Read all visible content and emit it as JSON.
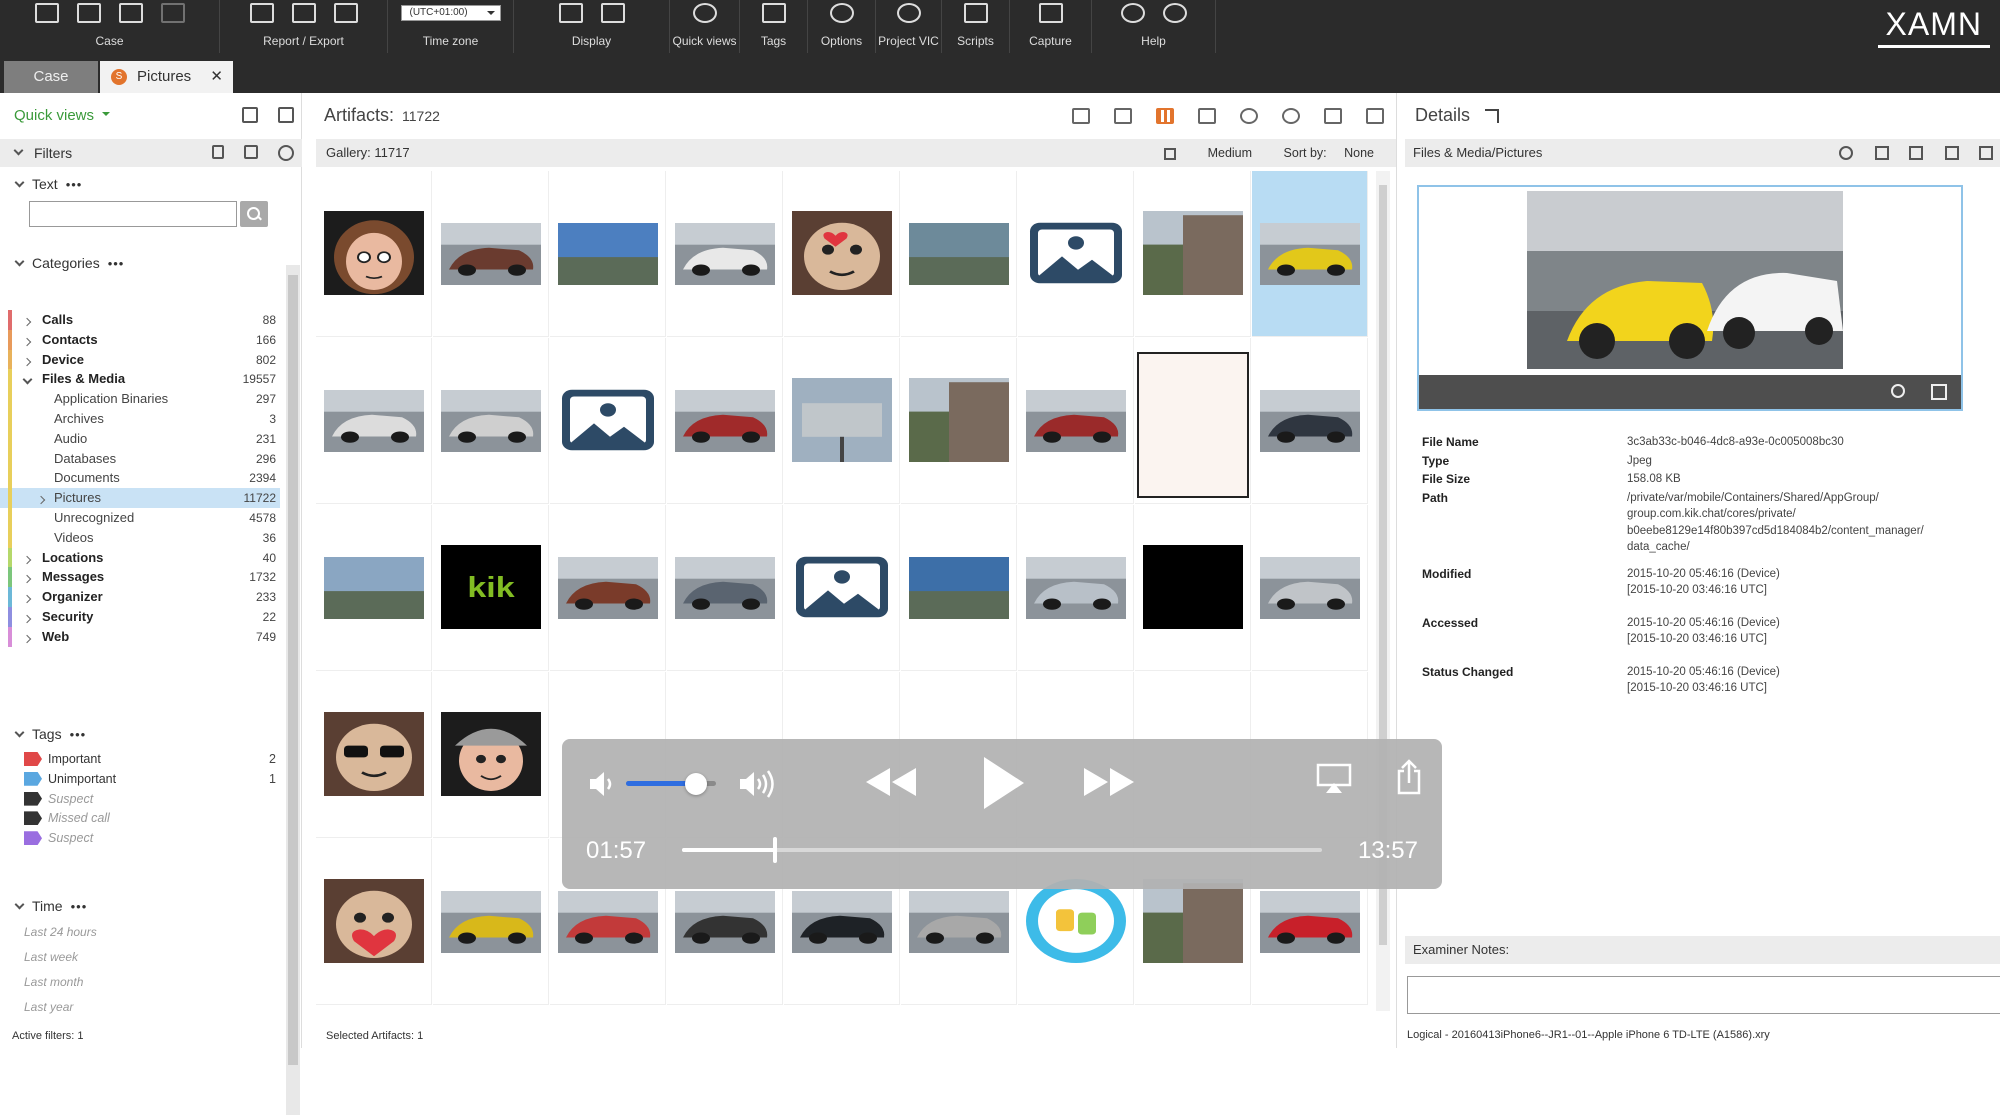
{
  "ribbon": {
    "groups": [
      {
        "label": "Case"
      },
      {
        "label": "Report / Export"
      },
      {
        "label": "Time zone"
      },
      {
        "label": "Display"
      },
      {
        "label": "Quick views"
      },
      {
        "label": "Tags"
      },
      {
        "label": "Options"
      },
      {
        "label": "Project VIC"
      },
      {
        "label": "Scripts"
      },
      {
        "label": "Capture"
      },
      {
        "label": "Help"
      }
    ],
    "timezone_value": "(UTC+01:00)",
    "logo": "XAMN"
  },
  "tabs": [
    {
      "label": "Case"
    },
    {
      "label": "Pictures",
      "badge": "S",
      "close": "✕"
    }
  ],
  "left": {
    "quick_views": "Quick views",
    "filters_label": "Filters",
    "text_label": "Text",
    "categories_label": "Categories",
    "categories": [
      {
        "label": "Calls",
        "count": "88",
        "color": "#e06c6c"
      },
      {
        "label": "Contacts",
        "count": "166",
        "color": "#e89a5b"
      },
      {
        "label": "Device",
        "count": "802",
        "color": "#e8b25b"
      },
      {
        "label": "Files & Media",
        "count": "19557",
        "color": "#e8cf5b"
      },
      {
        "label": "Application Binaries",
        "count": "297",
        "color": "#e8cf5b"
      },
      {
        "label": "Archives",
        "count": "3",
        "color": "#e8cf5b"
      },
      {
        "label": "Audio",
        "count": "231",
        "color": "#e8cf5b"
      },
      {
        "label": "Databases",
        "count": "296",
        "color": "#e8cf5b"
      },
      {
        "label": "Documents",
        "count": "2394",
        "color": "#e8cf5b"
      },
      {
        "label": "Pictures",
        "count": "11722",
        "color": "#e8cf5b"
      },
      {
        "label": "Unrecognized",
        "count": "4578",
        "color": "#e8cf5b"
      },
      {
        "label": "Videos",
        "count": "36",
        "color": "#e8cf5b"
      },
      {
        "label": "Locations",
        "count": "40",
        "color": "#b5d86b"
      },
      {
        "label": "Messages",
        "count": "1732",
        "color": "#7cc67c"
      },
      {
        "label": "Organizer",
        "count": "233",
        "color": "#6cb8d8"
      },
      {
        "label": "Security",
        "count": "22",
        "color": "#8e8ee0"
      },
      {
        "label": "Web",
        "count": "749",
        "color": "#d88ed8"
      }
    ],
    "tags_label": "Tags",
    "tags": [
      {
        "label": "Important",
        "count": "2",
        "color": "#e04848"
      },
      {
        "label": "Unimportant",
        "count": "1",
        "color": "#5aa7e0"
      },
      {
        "label": "Suspect",
        "count": "",
        "color": "#333333"
      },
      {
        "label": "Missed call",
        "count": "",
        "color": "#333333"
      },
      {
        "label": "Suspect",
        "count": "",
        "color": "#9a6ee0"
      }
    ],
    "time_label": "Time",
    "time_items": [
      "Last 24 hours",
      "Last week",
      "Last month",
      "Last year"
    ],
    "active_filters": "Active filters: 1"
  },
  "center": {
    "artifacts_label": "Artifacts:",
    "artifacts_count": "11722",
    "gallery_label": "Gallery:",
    "gallery_count": "11717",
    "size_option": "Medium",
    "sort_label": "Sort by:",
    "sort_value": "None",
    "selected_artifacts": "Selected Artifacts: 1"
  },
  "details": {
    "title": "Details",
    "path_bar": "Files & Media/Pictures",
    "props": [
      {
        "label": "File Name",
        "value": [
          "3c3ab33c-b046-4dc8-a93e-0c005008bc30"
        ]
      },
      {
        "label": "Type",
        "value": [
          "Jpeg"
        ]
      },
      {
        "label": "File Size",
        "value": [
          "158.08 KB"
        ]
      },
      {
        "label": "Path",
        "value": [
          "/private/var/mobile/Containers/Shared/AppGroup/",
          "group.com.kik.chat/cores/private/",
          "b0eebe8129e14f80b397cd5d184084b2/content_manager/",
          "data_cache/"
        ]
      },
      {
        "label": "Modified",
        "value": [
          "2015-10-20 05:46:16 (Device)",
          "[2015-10-20 03:46:16 UTC]"
        ]
      },
      {
        "label": "Accessed",
        "value": [
          "2015-10-20 05:46:16 (Device)",
          "[2015-10-20 03:46:16 UTC]"
        ]
      },
      {
        "label": "Status Changed",
        "value": [
          "2015-10-20 05:46:16 (Device)",
          "[2015-10-20 03:46:16 UTC]"
        ]
      }
    ],
    "notes_label": "Examiner Notes:",
    "status": "Logical - 20160413iPhone6--JR1--01--Apple iPhone 6 TD-LTE (A1586).xry"
  },
  "player": {
    "elapsed": "01:57",
    "remaining": "13:57",
    "volume_fraction": 0.78,
    "progress_fraction": 0.145
  },
  "gallery": [
    {
      "kind": "avatar-girl"
    },
    {
      "kind": "car-photo",
      "c": "#6a3b2f"
    },
    {
      "kind": "sky-photo",
      "c": "#4c7fc0"
    },
    {
      "kind": "car-photo",
      "c": "#e8e8e8"
    },
    {
      "kind": "sloth-kiss"
    },
    {
      "kind": "sky-photo",
      "c": "#6d8a9a"
    },
    {
      "kind": "placeholder"
    },
    {
      "kind": "building-photo"
    },
    {
      "kind": "car-photo",
      "c": "#e2c81a",
      "selected": true
    },
    {
      "kind": "car-photo",
      "c": "#dcdcdc"
    },
    {
      "kind": "car-photo",
      "c": "#cfcfcf"
    },
    {
      "kind": "placeholder"
    },
    {
      "kind": "car-photo",
      "c": "#a02a2a"
    },
    {
      "kind": "billboard"
    },
    {
      "kind": "building-photo"
    },
    {
      "kind": "car-photo",
      "c": "#9a2a2a"
    },
    {
      "kind": "blank-doc"
    },
    {
      "kind": "car-photo",
      "c": "#2f3640"
    },
    {
      "kind": "sky-photo",
      "c": "#8aa6c2"
    },
    {
      "kind": "kik-logo",
      "text": "kik"
    },
    {
      "kind": "car-photo",
      "c": "#7a3b2a"
    },
    {
      "kind": "car-photo",
      "c": "#5a6470"
    },
    {
      "kind": "placeholder"
    },
    {
      "kind": "sky-photo",
      "c": "#3d6fa8"
    },
    {
      "kind": "car-photo",
      "c": "#b8c0c8"
    },
    {
      "kind": "black"
    },
    {
      "kind": "car-photo",
      "c": "#c0c4c8"
    },
    {
      "kind": "sloth-glasses"
    },
    {
      "kind": "boy-cap"
    },
    {
      "kind": "hidden"
    },
    {
      "kind": "hidden"
    },
    {
      "kind": "hidden"
    },
    {
      "kind": "hidden"
    },
    {
      "kind": "hidden"
    },
    {
      "kind": "hidden"
    },
    {
      "kind": "hidden"
    },
    {
      "kind": "sloth-heart"
    },
    {
      "kind": "car-photo",
      "c": "#d8b81a"
    },
    {
      "kind": "car-photo",
      "c": "#c23a3a"
    },
    {
      "kind": "car-photo",
      "c": "#333333"
    },
    {
      "kind": "car-photo",
      "c": "#1e2226"
    },
    {
      "kind": "car-photo",
      "c": "#a8a8a8"
    },
    {
      "kind": "thumbs"
    },
    {
      "kind": "building-photo"
    },
    {
      "kind": "car-photo",
      "c": "#c8202a"
    }
  ]
}
